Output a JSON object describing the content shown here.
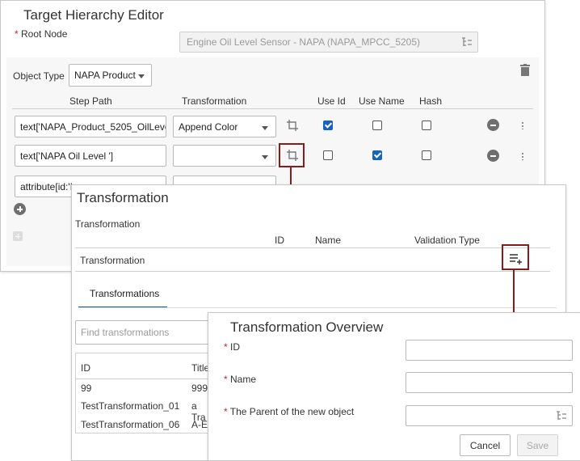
{
  "target_editor": {
    "title": "Target Hierarchy Editor",
    "root_node_label": "Root Node",
    "root_node_value": "Engine Oil Level Sensor - NAPA (NAPA_MPCC_5205)",
    "object_type_label": "Object Type",
    "object_type_value": "NAPA Product",
    "columns": {
      "step_path": "Step Path",
      "transformation": "Transformation",
      "use_id": "Use Id",
      "use_name": "Use Name",
      "hash": "Hash"
    },
    "rows": [
      {
        "step_path": "text['NAPA_Product_5205_OilLeve",
        "transformation": "Append Color",
        "use_id": true,
        "use_name": false,
        "hash": false
      },
      {
        "step_path": "text['NAPA Oil Level ']",
        "transformation": "",
        "use_id": false,
        "use_name": true,
        "hash": false
      },
      {
        "step_path": "attribute[id:'I",
        "transformation": ""
      }
    ]
  },
  "transformation_dialog": {
    "title": "Transformation",
    "section_label": "Transformation",
    "columns": {
      "id": "ID",
      "name": "Name",
      "validation_type": "Validation Type"
    },
    "row_label": "Transformation",
    "tab_label": "Transformations",
    "search_placeholder": "Find transformations",
    "list_columns": {
      "id": "ID",
      "title": "Title"
    },
    "list_rows": [
      {
        "id": "99",
        "title": "999"
      },
      {
        "id": "TestTransformation_01",
        "title": "a Tra"
      },
      {
        "id": "TestTransformation_06",
        "title": "A-Er"
      }
    ]
  },
  "overview_dialog": {
    "title": "Transformation Overview",
    "id_label": "ID",
    "name_label": "Name",
    "parent_label": "The Parent of the new object",
    "cancel_label": "Cancel",
    "save_label": "Save"
  },
  "colors": {
    "accent": "#1565c0",
    "annotation": "#8b1a1a",
    "tab_underline": "#1a5a96"
  }
}
